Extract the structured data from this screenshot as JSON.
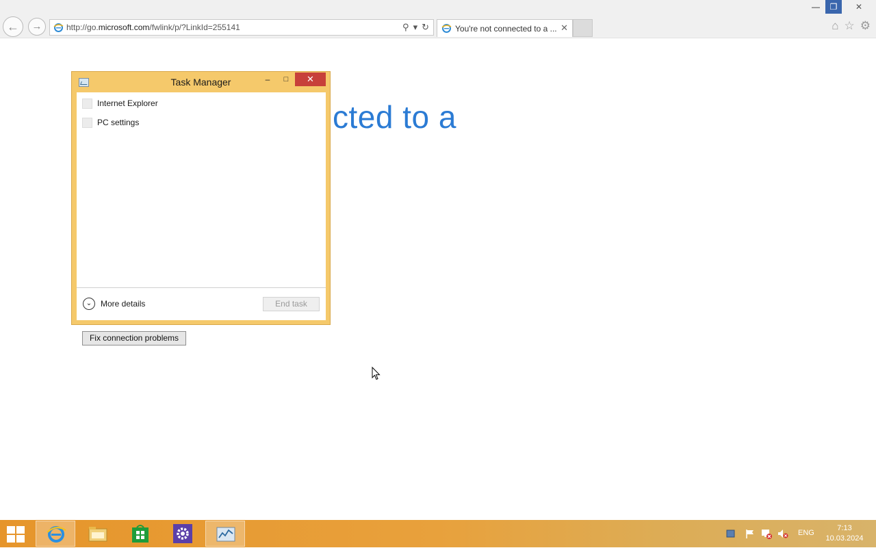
{
  "browser": {
    "address_url_prefix": "http://go.",
    "address_url_domain": "microsoft.com",
    "address_url_suffix": "/fwlink/p/?LinkId=255141",
    "tab_title": "You're not connected to a ...",
    "tab_close": "✕"
  },
  "page": {
    "heading_visible": "cted to a",
    "fix_button": "Fix connection problems"
  },
  "task_manager": {
    "title": "Task Manager",
    "apps": [
      {
        "name": "Internet Explorer"
      },
      {
        "name": "PC settings"
      }
    ],
    "more_details": "More details",
    "end_task": "End task"
  },
  "taskbar": {
    "language": "ENG",
    "time": "7:13",
    "date": "10.03.2024",
    "pinned": [
      "ie-icon",
      "file-explorer-icon",
      "store-icon",
      "settings-icon",
      "task-manager-icon"
    ]
  },
  "colors": {
    "tm_frame": "#f5c96b",
    "tm_close": "#c7403a",
    "heading": "#2b7bd4",
    "taskbar": "#e6952b"
  }
}
